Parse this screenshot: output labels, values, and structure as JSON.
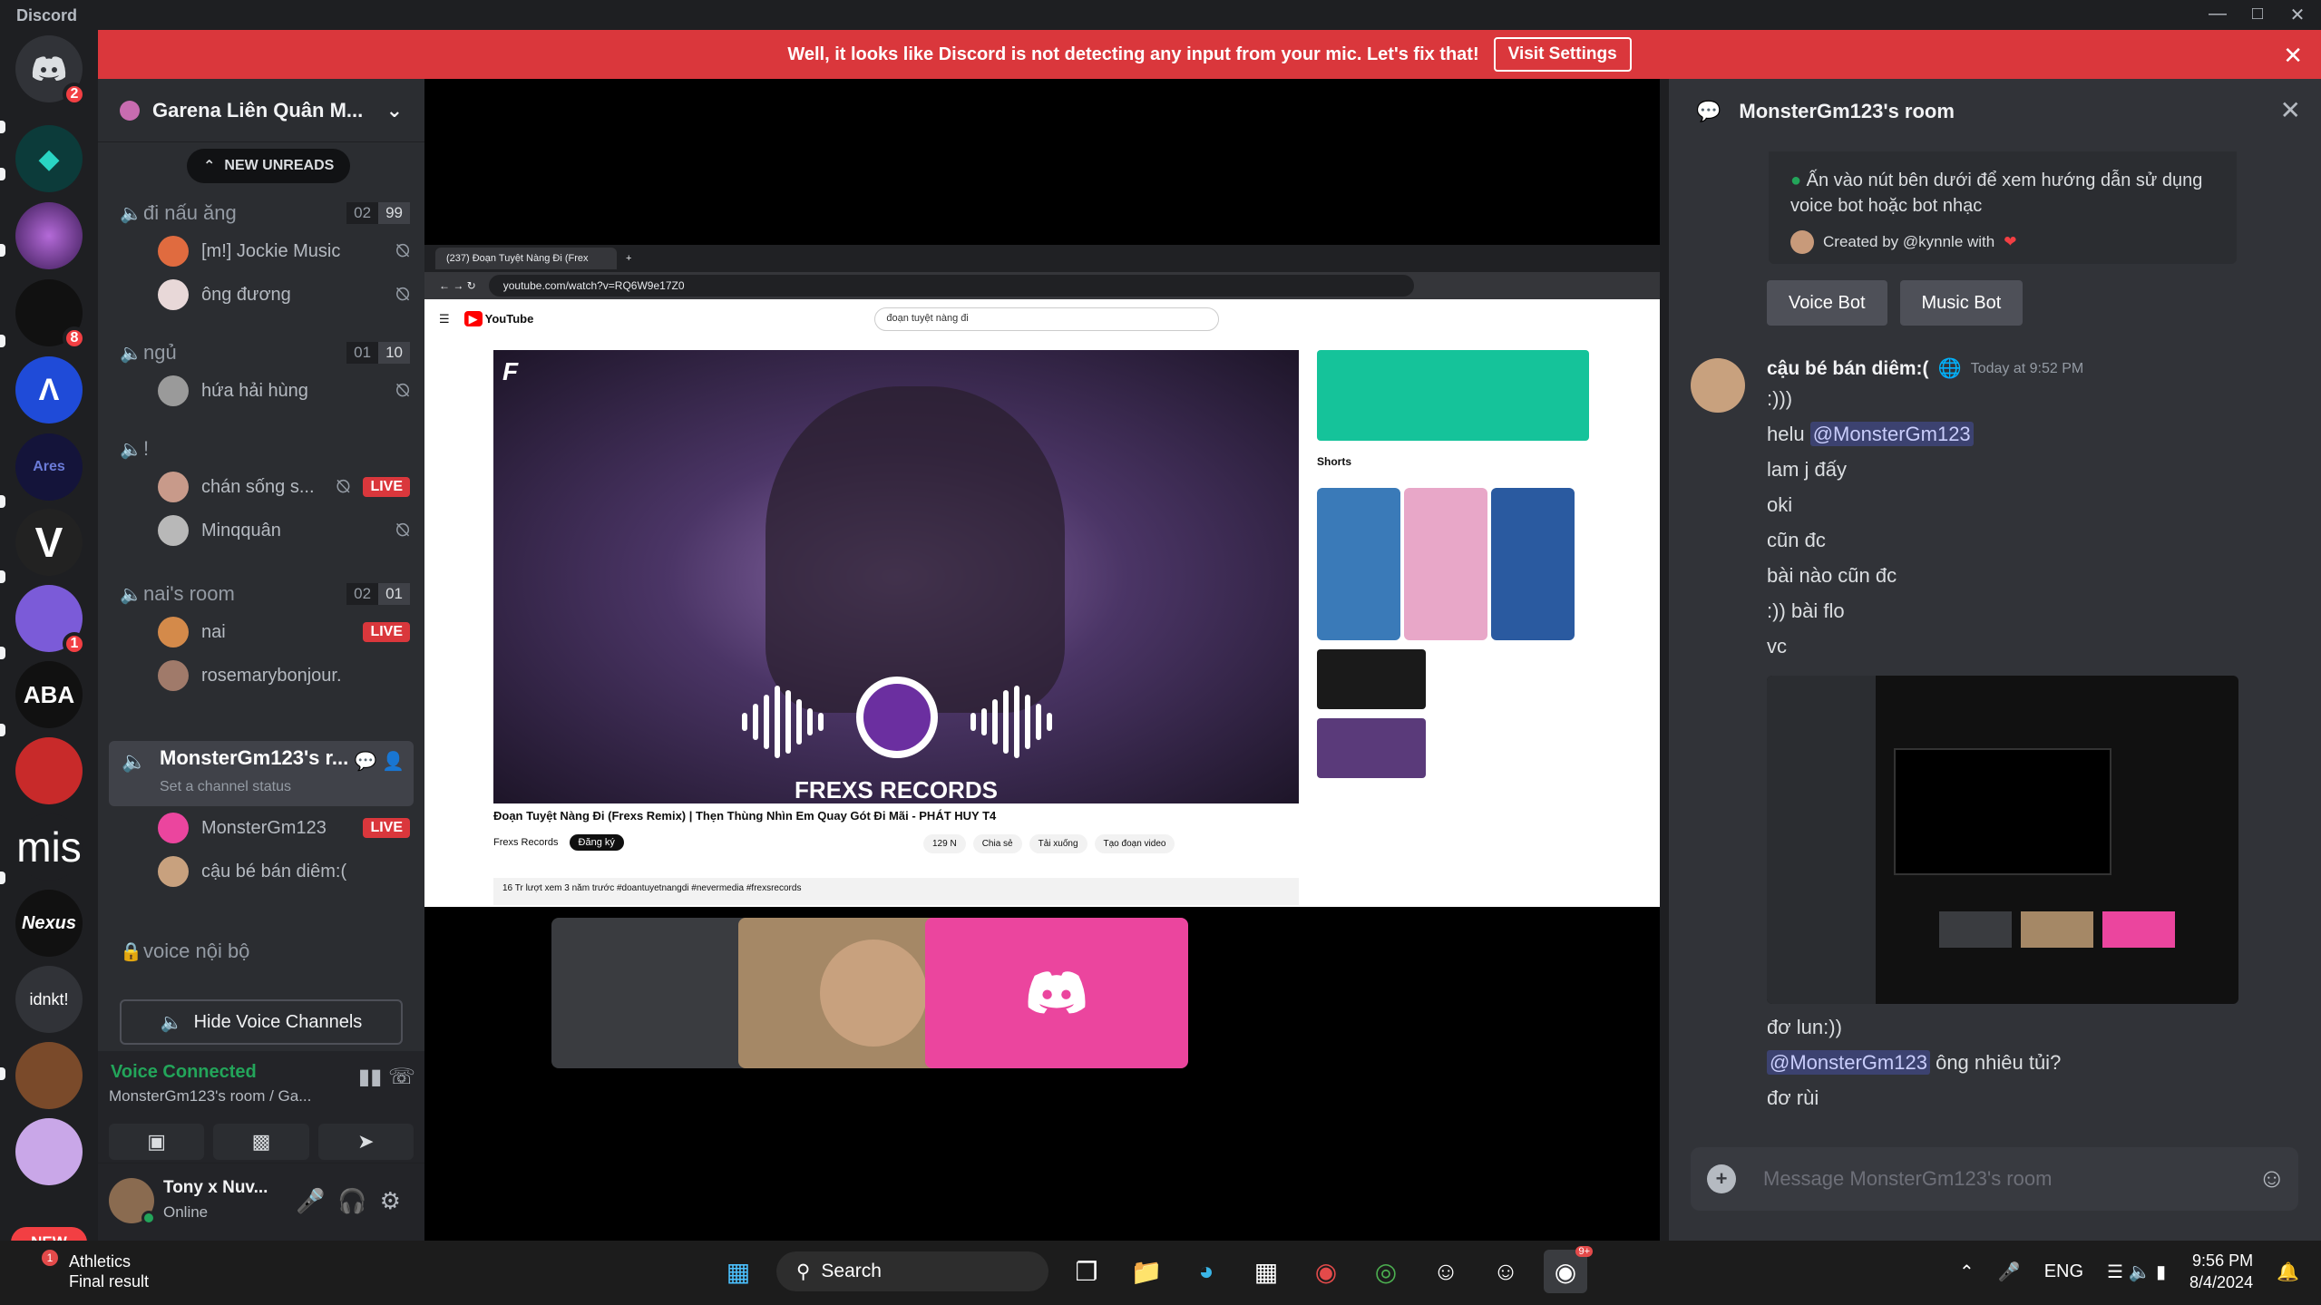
{
  "app": {
    "title": "Discord"
  },
  "colors": {
    "accent": "#5865f2",
    "live": "#da373c",
    "online": "#23a55a",
    "banner": "#da373c",
    "discord_pink": "#eb459e"
  },
  "banner": {
    "text": "Well, it looks like Discord is not detecting any input from your mic. Let's fix that!",
    "button": "Visit Settings"
  },
  "servers": {
    "badges": {
      "home": "2",
      "s4": "8",
      "s8": "1"
    },
    "labels": {
      "mis": "mis",
      "nexus": "Nexus",
      "idnkt": "idnkt!",
      "ares": "Ares",
      "aba": "ABA"
    },
    "new_label": "NEW"
  },
  "guild": {
    "name": "Garena Liên Quân M...",
    "new_unreads": "NEW UNREADS"
  },
  "channels": [
    {
      "name": "đi nấu ăng",
      "count_a": "02",
      "count_b": "99",
      "users": [
        {
          "name": "[m!] Jockie Music"
        },
        {
          "name": "ông đương"
        }
      ]
    },
    {
      "name": "ngủ",
      "count_a": "01",
      "count_b": "10",
      "users": [
        {
          "name": "hứa hải hùng"
        }
      ]
    },
    {
      "name": "!",
      "users": [
        {
          "name": "chán sống s..."
        },
        {
          "name": "Minqquân"
        }
      ]
    },
    {
      "name": "nai's room",
      "count_a": "02",
      "count_b": "01",
      "users": [
        {
          "name": "nai"
        },
        {
          "name": "rosemarybonjour."
        }
      ]
    }
  ],
  "active_channel": {
    "name": "MonsterGm123's r...",
    "status": "Set a channel status",
    "users": [
      {
        "name": "MonsterGm123"
      },
      {
        "name": "cậu bé bán diêm:("
      }
    ]
  },
  "live_label": "LIVE",
  "locked_channel": "voice nội bộ",
  "hide_voice": "Hide Voice Channels",
  "voice": {
    "status": "Voice Connected",
    "location": "MonsterGm123's room / Ga..."
  },
  "user": {
    "name": "Tony x Nuv...",
    "status": "Online"
  },
  "stream": {
    "tab_title": "(237) Đoạn Tuyệt Nàng Đi (Frex",
    "url": "youtube.com/watch?v=RQ6W9e17Z0",
    "search_text": "đoạn tuyệt nàng đi",
    "video_title": "Đoạn Tuyệt Nàng Đi (Frexs Remix) | Thẹn Thùng Nhìn Em Quay Gót Đi Mãi - PHÁT HUY T4",
    "channel": "Frexs Records",
    "subscribe": "Đăng ký",
    "likes": "129 N",
    "share": "Chia sẻ",
    "download": "Tải xuống",
    "clip": "Tạo đoạn video",
    "desc": "16 Tr lượt xem 3 năm trước #doantuyetnangdi #nevermedia #frexsrecords",
    "brand": "FREXS RECORDS",
    "shorts": "Shorts",
    "youtube": "YouTube"
  },
  "panel": {
    "title": "MonsterGm123's room",
    "embed_text": "Ấn vào nút bên dưới để xem hướng dẫn sử dụng voice bot hoặc bot nhạc",
    "created_by": "Created by @kynnle with",
    "buttons": [
      "Voice Bot",
      "Music Bot"
    ],
    "author": "cậu bé bán diêm:(",
    "time": "Today at 9:52 PM",
    "messages": [
      ":)))",
      "helu",
      "lam j đấy",
      "oki",
      "cũn đc",
      "bài nào cũn đc",
      ":)) bài flo",
      "vc"
    ],
    "mention": "@MonsterGm123",
    "after": [
      "đơ lun:))",
      "ông nhiêu tủi?",
      "đơ rùi"
    ],
    "composer_placeholder": "Message MonsterGm123's room"
  },
  "taskbar": {
    "weather_title": "Athletics",
    "weather_sub": "Final result",
    "weather_badge": "1",
    "search": "Search",
    "lang": "ENG",
    "time": "9:56 PM",
    "date": "8/4/2024",
    "discord_badge": "9+"
  }
}
